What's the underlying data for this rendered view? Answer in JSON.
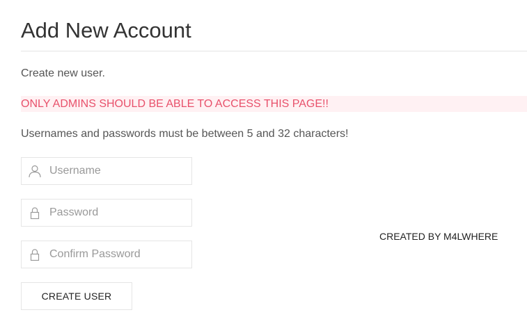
{
  "header": {
    "title": "Add New Account"
  },
  "messages": {
    "intro": "Create new user.",
    "warning": "ONLY ADMINS SHOULD BE ABLE TO ACCESS THIS PAGE!!",
    "requirements": "Usernames and passwords must be between 5 and 32 characters!"
  },
  "form": {
    "username": {
      "icon": "user-icon",
      "value": "",
      "placeholder": "Username"
    },
    "password": {
      "icon": "lock-icon",
      "value": "",
      "placeholder": "Password"
    },
    "confirm_password": {
      "icon": "lock-icon",
      "value": "",
      "placeholder": "Confirm Password"
    },
    "submit_label": "CREATE USER"
  },
  "footer": {
    "credit": "CREATED BY M4LWHERE"
  },
  "colors": {
    "warning_text": "#e8516b",
    "warning_background": "#fff1f3",
    "border": "#e5e5e5"
  }
}
